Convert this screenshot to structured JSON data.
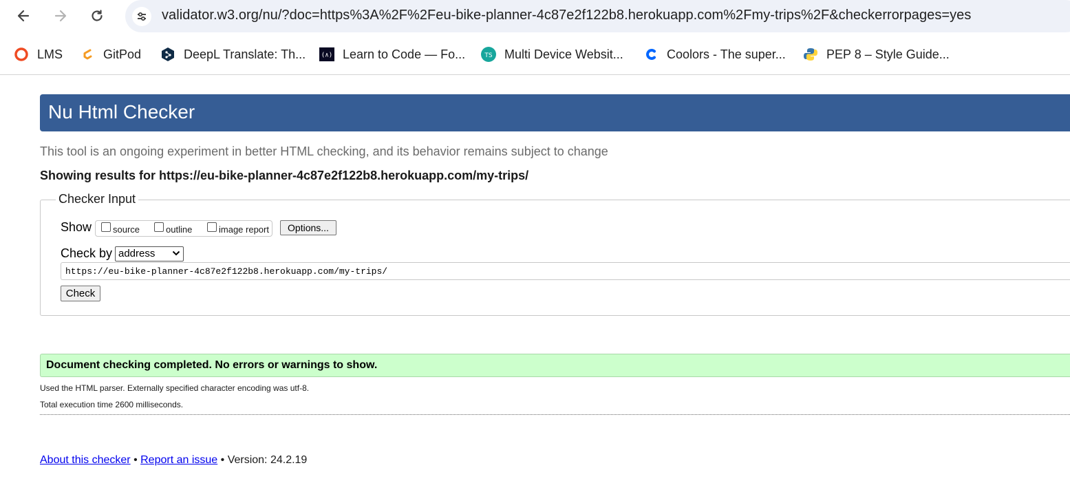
{
  "browser": {
    "url": "validator.w3.org/nu/?doc=https%3A%2F%2Feu-bike-planner-4c87e2f122b8.herokuapp.com%2Fmy-trips%2F&checkerrorpages=yes",
    "bookmarks": [
      {
        "label": "LMS",
        "icon": "lms-icon"
      },
      {
        "label": "GitPod",
        "icon": "gitpod-icon"
      },
      {
        "label": "DeepL Translate: Th...",
        "icon": "deepl-icon"
      },
      {
        "label": "Learn to Code — Fo...",
        "icon": "freecodecamp-icon"
      },
      {
        "label": "Multi Device Websit...",
        "icon": "ts-icon"
      },
      {
        "label": "Coolors - The super...",
        "icon": "coolors-icon"
      },
      {
        "label": "PEP 8 – Style Guide...",
        "icon": "python-icon"
      }
    ]
  },
  "page": {
    "title": "Nu Html Checker",
    "tagline": "This tool is an ongoing experiment in better HTML checking, and its behavior remains subject to change",
    "showing_results": "Showing results for https://eu-bike-planner-4c87e2f122b8.herokuapp.com/my-trips/"
  },
  "checker_input": {
    "legend": "Checker Input",
    "show_label": "Show",
    "show_options": {
      "source": "source",
      "outline": "outline",
      "image_report": "image report"
    },
    "options_button": "Options...",
    "check_by_label": "Check by",
    "check_by_value": "address",
    "address_value": "https://eu-bike-planner-4c87e2f122b8.herokuapp.com/my-trips/",
    "check_button": "Check"
  },
  "results": {
    "success_message": "Document checking completed. No errors or warnings to show.",
    "parser_info": "Used the HTML parser. Externally specified character encoding was utf-8.",
    "execution_time": "Total execution time 2600 milliseconds."
  },
  "footer": {
    "about_link": "About this checker",
    "sep1": " • ",
    "report_link": "Report an issue",
    "sep2": " • ",
    "version": "Version: 24.2.19"
  },
  "colors": {
    "banner": "#365d95",
    "success_bg": "#ccffcc",
    "link": "#0000ee"
  }
}
